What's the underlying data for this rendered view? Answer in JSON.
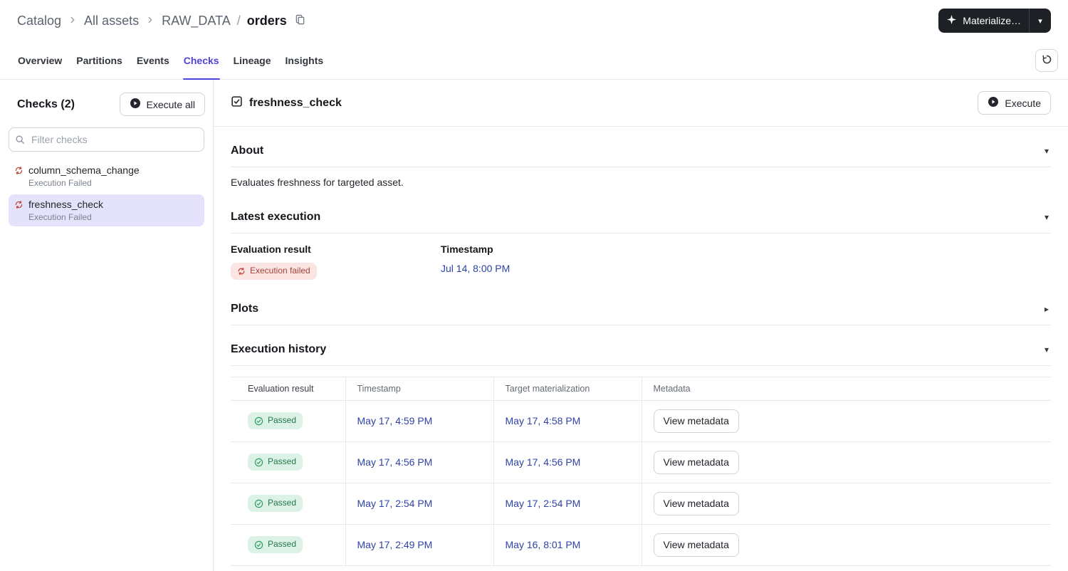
{
  "colors": {
    "accent": "#4F43DD",
    "link-blue": "#2D43A6",
    "border": "#E6E7EA",
    "selected-bg": "#E5E3FB",
    "dark-btn-bg": "#1D2126",
    "failed-bg": "#FAE5E2",
    "failed-text": "#A7403A",
    "failed-icon": "#C2473F",
    "passed-bg": "#DDF2E6",
    "passed-text": "#24774A",
    "passed-icon": "#2E9E63"
  },
  "breadcrumb": {
    "items": [
      "Catalog",
      "All assets",
      "RAW_DATA"
    ],
    "slash": "/",
    "current": "orders"
  },
  "topbar": {
    "materialize_label": "Materialize…",
    "caret": "▾"
  },
  "tabs": [
    {
      "label": "Overview"
    },
    {
      "label": "Partitions"
    },
    {
      "label": "Events"
    },
    {
      "label": "Checks"
    },
    {
      "label": "Lineage"
    },
    {
      "label": "Insights"
    }
  ],
  "active_tab": "Checks",
  "sidebar": {
    "title": "Checks (2)",
    "execute_all_label": "Execute all",
    "filter_placeholder": "Filter checks",
    "items": [
      {
        "name": "column_schema_change",
        "status": "Execution Failed"
      },
      {
        "name": "freshness_check",
        "status": "Execution Failed"
      }
    ]
  },
  "main": {
    "title": "freshness_check",
    "execute_label": "Execute",
    "chevron_down": "▾",
    "chevron_right": "▸",
    "about": {
      "heading": "About",
      "description": "Evaluates freshness for targeted asset."
    },
    "latest": {
      "heading": "Latest execution",
      "result_label": "Evaluation result",
      "result_value": "Execution failed",
      "timestamp_label": "Timestamp",
      "timestamp_value": "Jul 14, 8:00 PM"
    },
    "plots": {
      "heading": "Plots"
    },
    "history": {
      "heading": "Execution history",
      "columns": [
        "Evaluation result",
        "Timestamp",
        "Target materialization",
        "Metadata"
      ],
      "rows": [
        {
          "result": "Passed",
          "timestamp": "May 17, 4:59 PM",
          "target": "May 17, 4:58 PM",
          "action": "View metadata"
        },
        {
          "result": "Passed",
          "timestamp": "May 17, 4:56 PM",
          "target": "May 17, 4:56 PM",
          "action": "View metadata"
        },
        {
          "result": "Passed",
          "timestamp": "May 17, 2:54 PM",
          "target": "May 17, 2:54 PM",
          "action": "View metadata"
        },
        {
          "result": "Passed",
          "timestamp": "May 17, 2:49 PM",
          "target": "May 16, 8:01 PM",
          "action": "View metadata"
        }
      ]
    }
  }
}
